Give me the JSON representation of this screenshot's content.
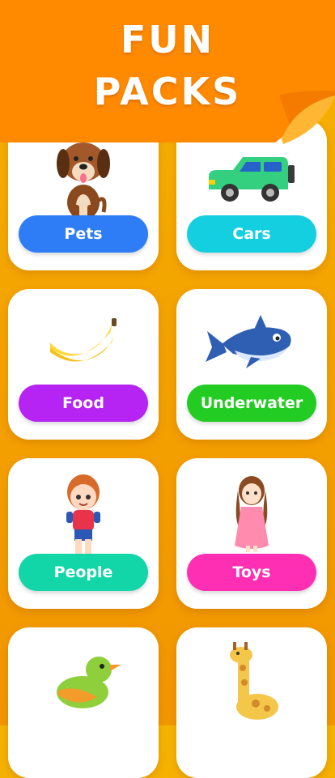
{
  "header": {
    "title_line1": "FUN",
    "title_line2": "PACKS",
    "colors": {
      "banner": "#ff8a00",
      "text": "#ffffff"
    }
  },
  "packs": [
    {
      "label": "Pets",
      "color": "#2f7df6",
      "icon": "dog-icon"
    },
    {
      "label": "Cars",
      "color": "#14cfe0",
      "icon": "car-icon"
    },
    {
      "label": "Food",
      "color": "#b524f2",
      "icon": "banana-icon"
    },
    {
      "label": "Underwater",
      "color": "#22cc22",
      "icon": "shark-icon"
    },
    {
      "label": "People",
      "color": "#12d6a8",
      "icon": "boy-icon"
    },
    {
      "label": "Toys",
      "color": "#ff2fb3",
      "icon": "doll-icon"
    },
    {
      "label": "",
      "color": "#ffffff",
      "icon": "bird-icon"
    },
    {
      "label": "",
      "color": "#ffffff",
      "icon": "giraffe-icon"
    }
  ]
}
